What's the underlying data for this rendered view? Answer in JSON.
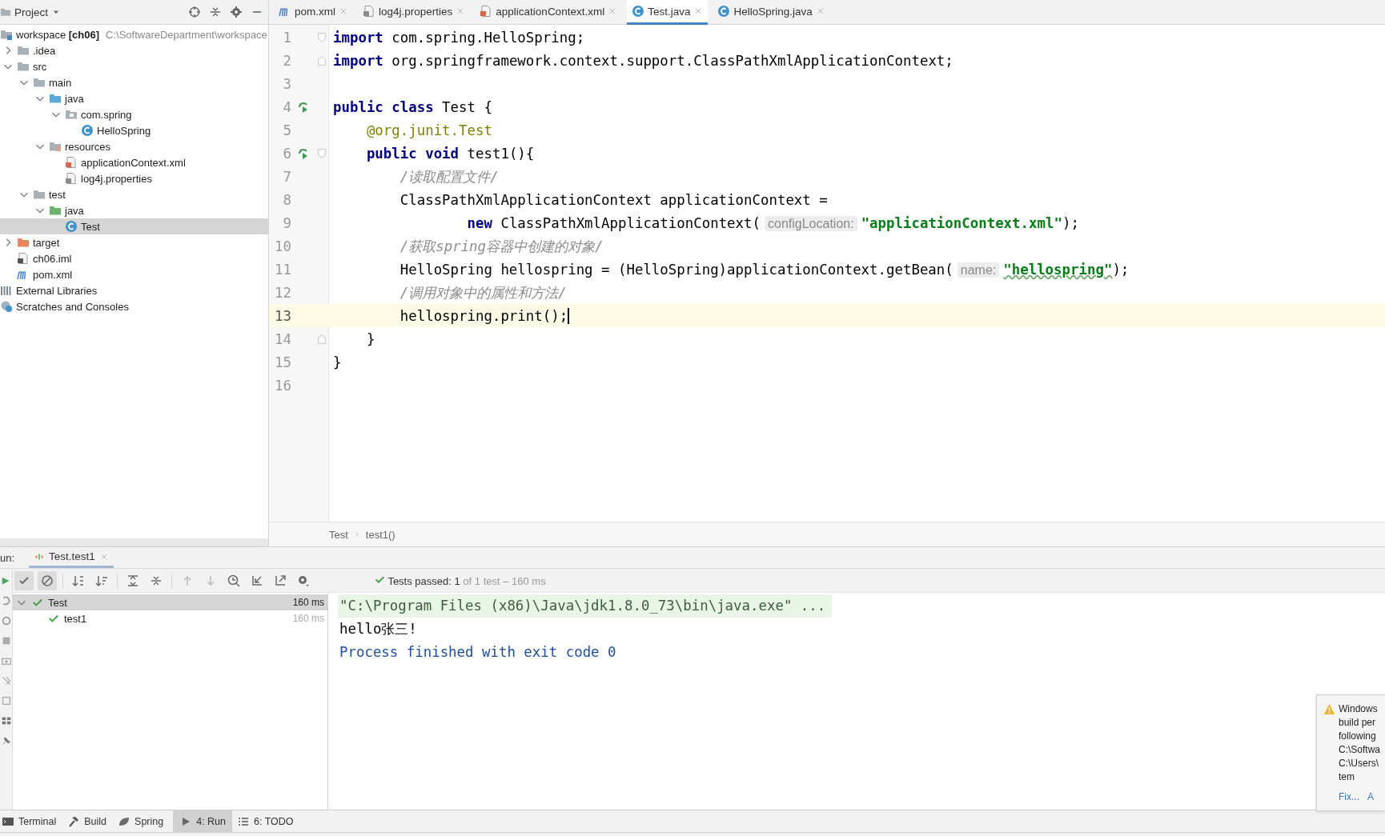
{
  "project_panel": {
    "title": "Project",
    "tree": [
      {
        "label": "workspace **[ch06]**",
        "path": "C:\\SoftwareDepartment\\workspace",
        "kind": "module",
        "selected": false,
        "children": [
          {
            "label": ".idea",
            "kind": "folder",
            "expanded": false,
            "selected": false
          },
          {
            "label": "src",
            "kind": "folder",
            "expanded": true,
            "selected": false,
            "children": [
              {
                "label": "main",
                "kind": "folder",
                "expanded": true,
                "selected": false,
                "children": [
                  {
                    "label": "java",
                    "kind": "source-folder",
                    "expanded": true,
                    "selected": false,
                    "children": [
                      {
                        "label": "com.spring",
                        "kind": "package",
                        "expanded": true,
                        "selected": false,
                        "children": [
                          {
                            "label": "HelloSpring",
                            "kind": "class",
                            "selected": false
                          }
                        ]
                      }
                    ]
                  },
                  {
                    "label": "resources",
                    "kind": "resources-folder",
                    "expanded": true,
                    "selected": false,
                    "children": [
                      {
                        "label": "applicationContext.xml",
                        "kind": "xml-file",
                        "selected": false
                      },
                      {
                        "label": "log4j.properties",
                        "kind": "properties-file",
                        "selected": false
                      }
                    ]
                  }
                ]
              },
              {
                "label": "test",
                "kind": "folder",
                "expanded": true,
                "selected": false,
                "children": [
                  {
                    "label": "java",
                    "kind": "test-folder",
                    "expanded": true,
                    "selected": false,
                    "children": [
                      {
                        "label": "Test",
                        "kind": "class",
                        "selected": true
                      }
                    ]
                  }
                ]
              }
            ]
          },
          {
            "label": "target",
            "kind": "excluded-folder",
            "expanded": false,
            "selected": false
          },
          {
            "label": "ch06.iml",
            "kind": "iml-file",
            "selected": false
          },
          {
            "label": "pom.xml",
            "kind": "maven-file",
            "selected": false
          }
        ]
      },
      {
        "label": "External Libraries",
        "kind": "libraries",
        "selected": false
      },
      {
        "label": "Scratches and Consoles",
        "kind": "scratches",
        "selected": false
      }
    ]
  },
  "editor": {
    "tabs": [
      {
        "label": "pom.xml",
        "kind": "maven-file",
        "selected": false
      },
      {
        "label": "log4j.properties",
        "kind": "properties-file",
        "selected": false
      },
      {
        "label": "applicationContext.xml",
        "kind": "xml-file",
        "selected": false
      },
      {
        "label": "Test.java",
        "kind": "class",
        "selected": true
      },
      {
        "label": "HelloSpring.java",
        "kind": "class",
        "selected": false
      }
    ],
    "lines": [
      {
        "number": "1",
        "kind": "fold-start",
        "current": false,
        "segments": [
          {
            "kind": "keyword",
            "text": "import"
          },
          {
            "kind": "plain",
            "text": " com.spring.HelloSpring;"
          }
        ]
      },
      {
        "number": "2",
        "kind": "fold-end",
        "current": false,
        "segments": [
          {
            "kind": "keyword",
            "text": "import"
          },
          {
            "kind": "plain",
            "text": " org.springframework.context.support.ClassPathXmlApplicationContext;"
          }
        ]
      },
      {
        "number": "3",
        "kind": "plain",
        "current": false
      },
      {
        "number": "4",
        "kind": "run",
        "current": false,
        "segments": [
          {
            "kind": "keyword",
            "text": "public class"
          },
          {
            "kind": "plain",
            "text": " Test {"
          }
        ]
      },
      {
        "number": "5",
        "kind": "plain",
        "current": false,
        "segments": [
          {
            "kind": "annotation",
            "text": "    @org.junit.Test"
          }
        ]
      },
      {
        "number": "6",
        "kind": "run-fold-start",
        "current": false,
        "segments": [
          {
            "kind": "keyword",
            "text": "    public void"
          },
          {
            "kind": "plain",
            "text": " test1(){"
          }
        ]
      },
      {
        "number": "7",
        "kind": "plain",
        "current": false,
        "segments": [
          {
            "kind": "comment",
            "text": "        /*读取配置文件*/"
          }
        ]
      },
      {
        "number": "8",
        "kind": "plain",
        "current": false,
        "segments": [
          {
            "kind": "plain",
            "text": "        ClassPathXmlApplicationContext applicationContext ="
          }
        ]
      },
      {
        "number": "9",
        "kind": "plain",
        "current": false,
        "segments": [
          {
            "kind": "keyword",
            "text": "                new"
          },
          {
            "kind": "plain",
            "text": " ClassPathXmlApplicationContext("
          },
          {
            "kind": "hint",
            "text": "configLocation:"
          },
          {
            "kind": "string",
            "text": "\"applicationContext.xml\""
          },
          {
            "kind": "plain",
            "text": ");"
          }
        ]
      },
      {
        "number": "10",
        "kind": "plain",
        "current": false,
        "segments": [
          {
            "kind": "comment",
            "text": "        /*获取spring容器中创建的对象*/"
          }
        ]
      },
      {
        "number": "11",
        "kind": "plain",
        "current": false,
        "segments": [
          {
            "kind": "plain",
            "text": "        HelloSpring hellospring = (HelloSpring)applicationContext.getBean("
          },
          {
            "kind": "hint",
            "text": "name:"
          },
          {
            "kind": "string",
            "text": "\"hellospring\"",
            "misspelled": true
          },
          {
            "kind": "plain",
            "text": ");"
          }
        ]
      },
      {
        "number": "12",
        "kind": "plain",
        "current": false,
        "segments": [
          {
            "kind": "comment",
            "text": "        /*调用对象中的属性和方法*/"
          }
        ]
      },
      {
        "number": "13",
        "kind": "plain",
        "current": true,
        "segments": [
          {
            "kind": "plain",
            "text": "        hellospring.print();"
          }
        ]
      },
      {
        "number": "14",
        "kind": "fold-end",
        "current": false,
        "segments": [
          {
            "kind": "plain",
            "text": "    }"
          }
        ]
      },
      {
        "number": "15",
        "kind": "plain",
        "current": false,
        "segments": [
          {
            "kind": "plain",
            "text": "}"
          }
        ]
      },
      {
        "number": "16",
        "kind": "plain",
        "current": false
      }
    ],
    "breadcrumbs": [
      "Test",
      "test1()"
    ]
  },
  "run_panel": {
    "label": "un:",
    "tabs": [
      {
        "label": "Test.test1",
        "selected": true
      }
    ],
    "status": "**Tests passed: 1** of 1 test – 160 ms",
    "results": [
      {
        "label": "Test",
        "time": "160 ms",
        "passed": true,
        "expanded": true,
        "selected": true,
        "children": [
          {
            "label": "test1",
            "time": "160 ms",
            "passed": true,
            "selected": false
          }
        ]
      }
    ],
    "console": [
      {
        "kind": "command",
        "text": "\"C:\\Program Files (x86)\\Java\\jdk1.8.0_73\\bin\\java.exe\" ..."
      },
      {
        "kind": "output",
        "text": "hello张三!"
      },
      {
        "kind": "system",
        "text": "Process finished with exit code 0"
      }
    ]
  },
  "notification": {
    "kind": "warning",
    "lines": [
      "Windows",
      "build per",
      "following",
      "C:\\Softwa",
      "C:\\Users\\",
      "tem"
    ],
    "actions": [
      "Fix...",
      "A"
    ]
  },
  "tool_windows": [
    {
      "label": "Terminal",
      "kind": "terminal",
      "selected": false
    },
    {
      "label": "Build",
      "kind": "hammer",
      "selected": false
    },
    {
      "label": "Spring",
      "kind": "leaf",
      "selected": false
    },
    {
      "label": "4: Run",
      "kind": "play",
      "selected": true
    },
    {
      "label": "6: TODO",
      "kind": "list",
      "selected": false
    }
  ]
}
